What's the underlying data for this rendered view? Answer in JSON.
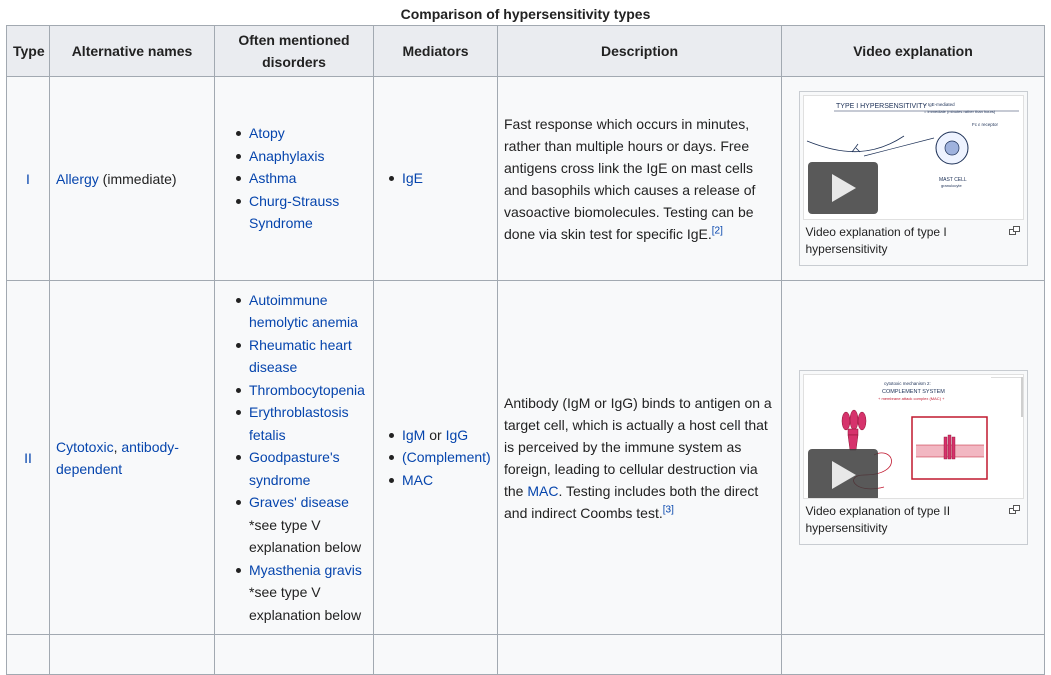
{
  "caption": "Comparison of hypersensitivity types",
  "headers": {
    "type": "Type",
    "alternative_names": "Alternative names",
    "disorders": "Often mentioned disorders",
    "mediators": "Mediators",
    "description": "Description",
    "video": "Video explanation"
  },
  "rows": [
    {
      "type": "I",
      "alt_link": "Allergy",
      "alt_text": " (immediate)",
      "disorders": [
        "Atopy",
        "Anaphylaxis",
        "Asthma",
        "Churg-Strauss Syndrome"
      ],
      "mediators": [
        "IgE"
      ],
      "description": "Fast response which occurs in minutes, rather than multiple hours or days. Free antigens cross link the IgE on mast cells and basophils which causes a release of vasoactive biomolecules. Testing can be done via skin test for specific IgE.",
      "ref": "[2]",
      "video_caption": "Video explanation of type I hypersensitivity",
      "thumb_title": "TYPE I HYPERSENSITIVITY",
      "thumb_sub1": "= IgE-mediated",
      "thumb_sub2": "= immediate (minutes rather than hours)",
      "thumb_label1": "Fc ε receptor",
      "thumb_label2": "MAST CELL",
      "thumb_label3": "granulocyte"
    },
    {
      "type": "II",
      "alt_link1": "Cytotoxic",
      "alt_sep": ", ",
      "alt_link2": "antibody-dependent",
      "disorders": [
        {
          "text": "Autoimmune hemolytic anemia"
        },
        {
          "text": "Rheumatic heart disease"
        },
        {
          "text": "Thrombocytopenia"
        },
        {
          "text": "Erythroblastosis fetalis"
        },
        {
          "text": "Goodpasture's syndrome"
        },
        {
          "text": "Graves' disease",
          "note": "*see type V explanation below"
        },
        {
          "text": "Myasthenia gravis",
          "note": "*see type V explanation below"
        }
      ],
      "mediators_a": "IgM",
      "mediators_or": " or ",
      "mediators_b": "IgG",
      "mediators_c": "(Complement)",
      "mediators_d": "MAC",
      "description_pre": "Antibody (IgM or IgG) binds to antigen on a target cell, which is actually a host cell that is perceived by the immune system as foreign, leading to cellular destruction via the ",
      "description_link": "MAC",
      "description_post": ". Testing includes both the direct and indirect Coombs test.",
      "ref": "[3]",
      "video_caption": "Video explanation of type II hypersensitivity",
      "thumb_title1": "cytotoxic mechanism 2:",
      "thumb_title2": "COMPLEMENT SYSTEM",
      "thumb_title3": "+ membrane attack complex (MAC) +"
    }
  ],
  "colors": {
    "link": "#0645ad",
    "header_bg": "#eaecf0",
    "cell_bg": "#f8f9fa",
    "border": "#a2a9b1",
    "thumb_red": "#c0182f"
  },
  "icons": [
    "play-icon",
    "magnify-icon"
  ]
}
